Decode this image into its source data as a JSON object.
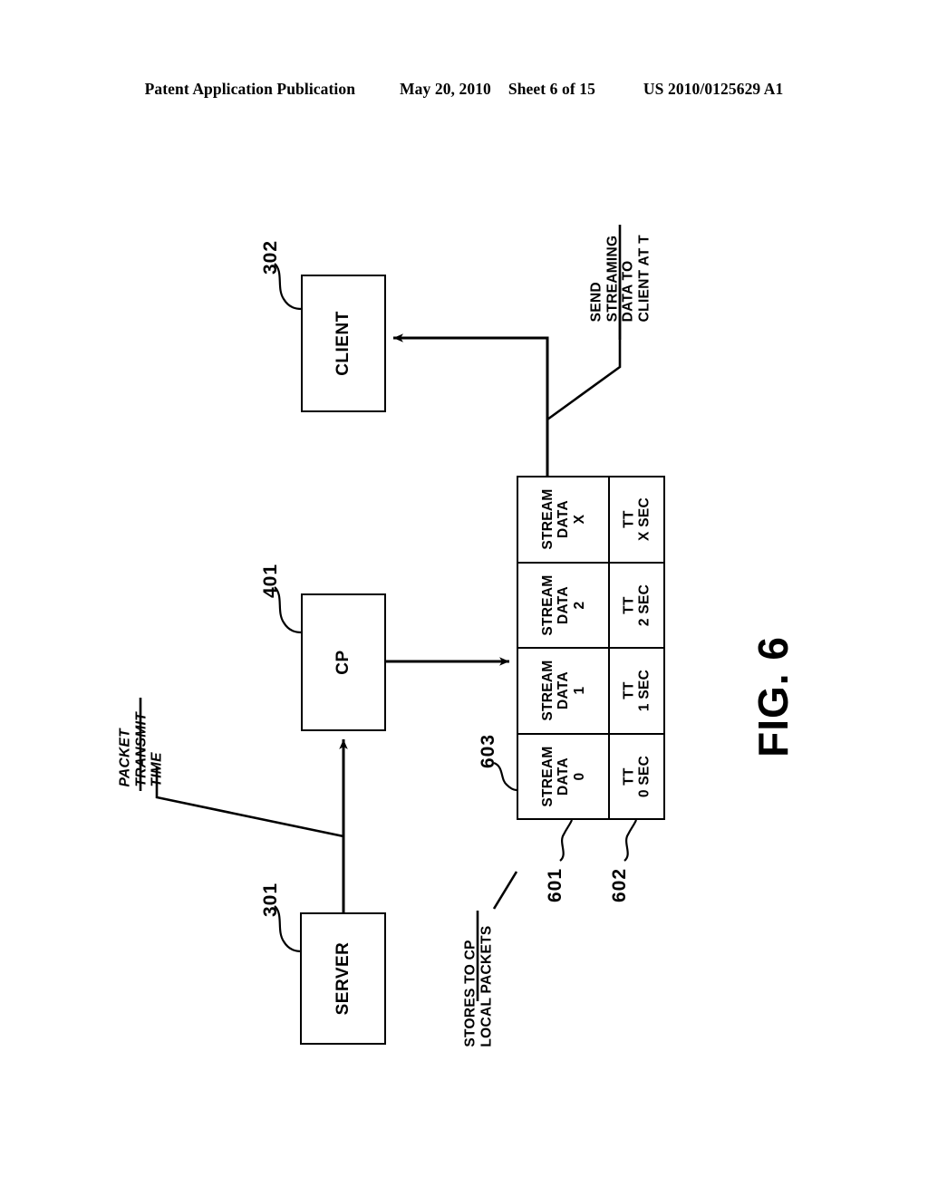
{
  "header": {
    "publication": "Patent Application Publication",
    "date": "May 20, 2010",
    "sheet": "Sheet 6 of 15",
    "docnum": "US 2010/0125629 A1"
  },
  "figure": {
    "caption": "FIG. 6"
  },
  "nodes": [
    {
      "id": "client",
      "label": "CLIENT",
      "ref": "302"
    },
    {
      "id": "cp",
      "label": "CP",
      "ref": "401"
    },
    {
      "id": "server",
      "label": "SERVER",
      "ref": "301"
    }
  ],
  "table": {
    "ref_body": "603",
    "ref_data_row": "601",
    "ref_tt_row": "602",
    "columns": [
      {
        "data": "STREAM\nDATA\n0",
        "tt": "TT\n0 SEC"
      },
      {
        "data": "STREAM\nDATA\n1",
        "tt": "TT\n1 SEC"
      },
      {
        "data": "STREAM\nDATA\n2",
        "tt": "TT\n2 SEC"
      },
      {
        "data": "STREAM\nDATA\nX",
        "tt": "TT\nX SEC"
      }
    ]
  },
  "annotations": {
    "send_streaming": "SEND\nSTREAMING\nDATA TO\nCLIENT AT T",
    "packet_transmit_time": "PACKET\nTRANSMIT\nTIME",
    "stores_to_cp": "STORES TO CP\nLOCAL PACKETS"
  },
  "colors": {
    "ink": "#000000",
    "paper": "#ffffff"
  }
}
